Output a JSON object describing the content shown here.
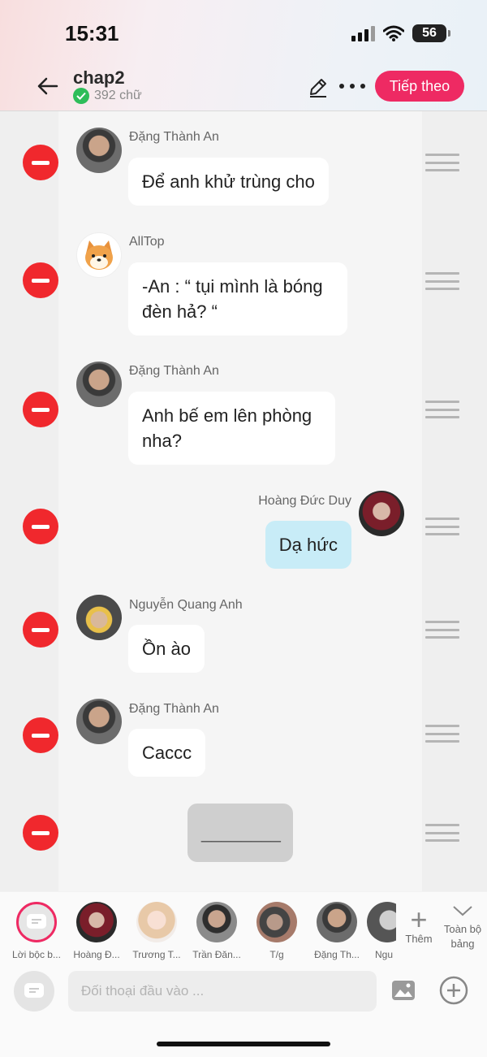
{
  "status_bar": {
    "time": "15:31",
    "battery": "56"
  },
  "header": {
    "title": "chap2",
    "word_count": "392 chữ",
    "next_label": "Tiếp theo"
  },
  "messages": [
    {
      "name": "Đặng Thành An",
      "text": "Để anh khử trùng cho",
      "side": "left",
      "avatar": "an"
    },
    {
      "name": "AllTop",
      "text": "-An : “ tụi mình là bóng đèn hả? “",
      "side": "left",
      "avatar": "shiba"
    },
    {
      "name": "Đặng Thành An",
      "text": "Anh bế em lên phòng nha?",
      "side": "left",
      "avatar": "an"
    },
    {
      "name": "Hoàng Đức Duy",
      "text": "Dạ hức",
      "side": "right",
      "avatar": "duy"
    },
    {
      "name": "Nguyễn Quang Anh",
      "text": "Ồn ào",
      "side": "left",
      "avatar": "quanganh"
    },
    {
      "name": "Đặng Thành An",
      "text": "Caccc",
      "side": "left",
      "avatar": "an"
    },
    {
      "name": "",
      "text": "________",
      "side": "center",
      "avatar": ""
    }
  ],
  "characters": [
    {
      "label": "Lời bộc b...",
      "avatar": "narrator"
    },
    {
      "label": "Hoàng Đ...",
      "avatar": "duy"
    },
    {
      "label": "Trương T...",
      "avatar": "anime"
    },
    {
      "label": "Trần Đăn...",
      "avatar": "tran"
    },
    {
      "label": "T/g",
      "avatar": "tg"
    },
    {
      "label": "Đặng Th...",
      "avatar": "an"
    },
    {
      "label": "Ngu",
      "avatar": "ngu"
    }
  ],
  "tray": {
    "add_label": "Thêm",
    "view_all_label": "Toàn bộ bảng"
  },
  "input": {
    "placeholder": "Đối thoại đầu vào ..."
  },
  "colors": {
    "accent": "#ee2a63",
    "delete": "#f0282d",
    "right_bubble": "#c8ecf7",
    "check": "#2ebd59"
  }
}
